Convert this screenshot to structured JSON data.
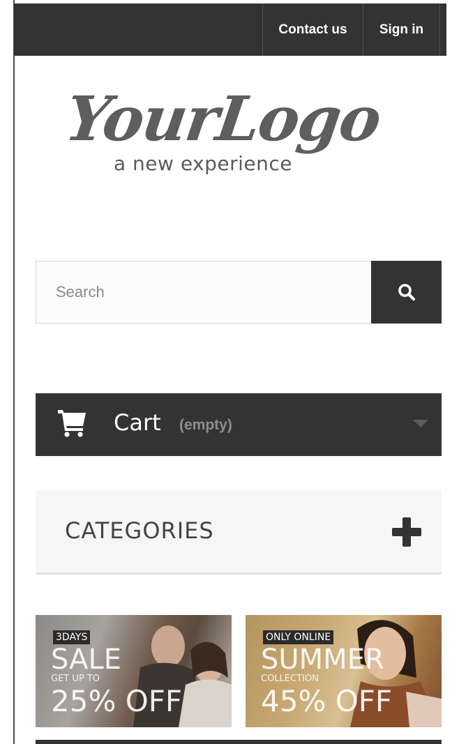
{
  "header": {
    "contact_label": "Contact us",
    "signin_label": "Sign in"
  },
  "logo": {
    "script_text": "YourLogo",
    "tagline": "a new experience"
  },
  "search": {
    "placeholder": "Search",
    "button_icon": "search-icon"
  },
  "cart": {
    "icon": "cart-icon",
    "label": "Cart",
    "status": "(empty)",
    "toggle_icon": "chevron-down-icon"
  },
  "categories": {
    "title": "CATEGORIES",
    "toggle_icon": "plus-icon"
  },
  "banners": [
    {
      "badge": "3DAYS",
      "headline": "SALE",
      "subline": "GET UP TO",
      "offer": "25% OFF"
    },
    {
      "badge": "ONLY ONLINE",
      "headline": "SUMMER",
      "subline": "COLLECTION",
      "offer": "45% OFF"
    }
  ],
  "colors": {
    "dark": "#333333",
    "light_panel": "#f6f6f6",
    "text_dark": "#444444",
    "muted": "#8e8e8e"
  }
}
